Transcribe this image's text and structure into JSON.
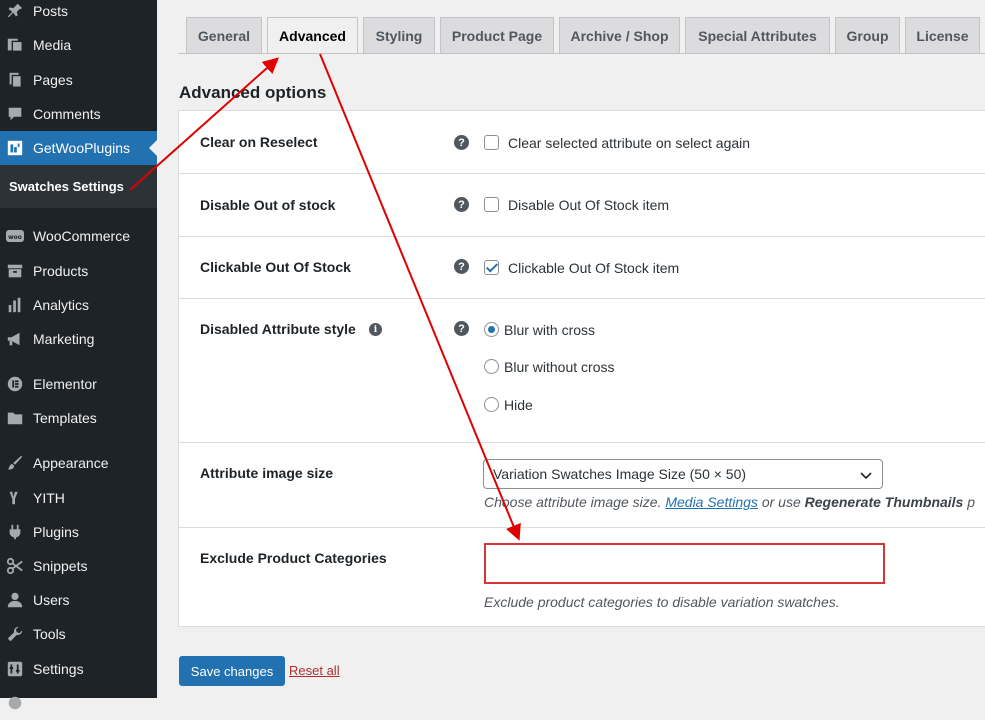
{
  "sidebar": {
    "items": [
      {
        "label": "Posts",
        "icon": "pushpin-icon"
      },
      {
        "label": "Media",
        "icon": "media-icon"
      },
      {
        "label": "Pages",
        "icon": "pages-icon"
      },
      {
        "label": "Comments",
        "icon": "comment-icon"
      },
      {
        "label": "GetWooPlugins",
        "icon": "getwooplugins-icon"
      },
      {
        "label": "WooCommerce",
        "icon": "woocommerce-icon"
      },
      {
        "label": "Products",
        "icon": "products-icon"
      },
      {
        "label": "Analytics",
        "icon": "analytics-icon"
      },
      {
        "label": "Marketing",
        "icon": "megaphone-icon"
      },
      {
        "label": "Elementor",
        "icon": "elementor-icon"
      },
      {
        "label": "Templates",
        "icon": "folder-icon"
      },
      {
        "label": "Appearance",
        "icon": "brush-icon"
      },
      {
        "label": "YITH",
        "icon": "yith-icon"
      },
      {
        "label": "Plugins",
        "icon": "plugin-icon"
      },
      {
        "label": "Snippets",
        "icon": "scissors-icon"
      },
      {
        "label": "Users",
        "icon": "user-icon"
      },
      {
        "label": "Tools",
        "icon": "wrench-icon"
      },
      {
        "label": "Settings",
        "icon": "settings-icon"
      }
    ],
    "submenu_label": "Swatches Settings"
  },
  "tabs": [
    "General",
    "Advanced",
    "Styling",
    "Product Page",
    "Archive / Shop",
    "Special Attributes",
    "Group",
    "License"
  ],
  "active_tab": "Advanced",
  "section_title": "Advanced options",
  "settings": {
    "clear_reselect": {
      "label": "Clear on Reselect",
      "option": "Clear selected attribute on select again",
      "checked": false
    },
    "disable_oos": {
      "label": "Disable Out of stock",
      "option": "Disable Out Of Stock item",
      "checked": false
    },
    "clickable_oos": {
      "label": "Clickable Out Of Stock",
      "option": "Clickable Out Of Stock item",
      "checked": true
    },
    "disabled_style": {
      "label": "Disabled Attribute style",
      "options": [
        "Blur with cross",
        "Blur without cross",
        "Hide"
      ],
      "selected": "Blur with cross"
    },
    "image_size": {
      "label": "Attribute image size",
      "value": "Variation Swatches Image Size (50 × 50)",
      "desc_prefix": "Choose attribute image size.",
      "desc_link": "Media Settings",
      "desc_mid": "or use",
      "desc_bold": "Regenerate Thumbnails",
      "desc_suffix": "p"
    },
    "exclude_cats": {
      "label": "Exclude Product Categories",
      "value": "",
      "desc": "Exclude product categories to disable variation swatches."
    }
  },
  "buttons": {
    "save": "Save changes",
    "reset": "Reset all"
  },
  "colors": {
    "sidebar_bg": "#1d2327",
    "accent": "#2271b1",
    "annotation": "#e00000",
    "danger": "#d63638"
  }
}
